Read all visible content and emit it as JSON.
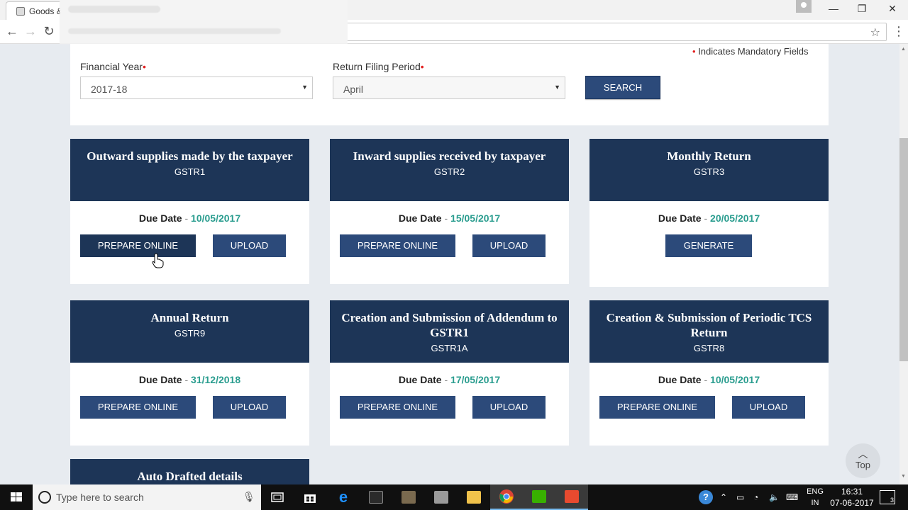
{
  "browser": {
    "tab_title": "Goods &",
    "minimize_glyph": "—",
    "maximize_glyph": "❐",
    "close_glyph": "✕",
    "back_glyph": "←",
    "forward_glyph": "→",
    "reload_glyph": "↻",
    "star_glyph": "☆",
    "menu_glyph": "⋮"
  },
  "filters": {
    "mandatory_note": "Indicates Mandatory Fields",
    "financial_year_label": "Financial Year",
    "financial_year_value": "2017-18",
    "period_label": "Return Filing Period",
    "period_value": "April",
    "required_marker": "•",
    "select_arrow": "▼",
    "search_label": "SEARCH"
  },
  "due_label": "Due Date",
  "due_separator": "-",
  "cards": [
    {
      "title": "Outward supplies made by the taxpayer",
      "code": "GSTR1",
      "due_date": "10/05/2017",
      "prepare_label": "PREPARE ONLINE",
      "upload_label": "UPLOAD"
    },
    {
      "title": "Inward supplies received by taxpayer",
      "code": "GSTR2",
      "due_date": "15/05/2017",
      "prepare_label": "PREPARE ONLINE",
      "upload_label": "UPLOAD"
    },
    {
      "title": "Monthly Return",
      "code": "GSTR3",
      "due_date": "20/05/2017",
      "generate_label": "GENERATE"
    },
    {
      "title": "Annual Return",
      "code": "GSTR9",
      "due_date": "31/12/2018",
      "prepare_label": "PREPARE ONLINE",
      "upload_label": "UPLOAD"
    },
    {
      "title": "Creation and Submission of Addendum to GSTR1",
      "code": "GSTR1A",
      "due_date": "17/05/2017",
      "prepare_label": "PREPARE ONLINE",
      "upload_label": "UPLOAD"
    },
    {
      "title": "Creation & Submission of Periodic TCS Return",
      "code": "GSTR8",
      "due_date": "10/05/2017",
      "prepare_label": "PREPARE ONLINE",
      "upload_label": "UPLOAD"
    }
  ],
  "auto_drafted_title": "Auto Drafted details",
  "top_button": {
    "label": "Top",
    "caret": "︿"
  },
  "taskbar": {
    "search_placeholder": "Type here to search",
    "lang_line1": "ENG",
    "lang_line2": "IN",
    "time": "16:31",
    "date": "07-06-2017",
    "notification_count": "3"
  },
  "colors": {
    "header_navy": "#1d3557",
    "button_blue": "#2c4a7a",
    "due_date_teal": "#2a9d8f",
    "required_red": "#e32020"
  }
}
